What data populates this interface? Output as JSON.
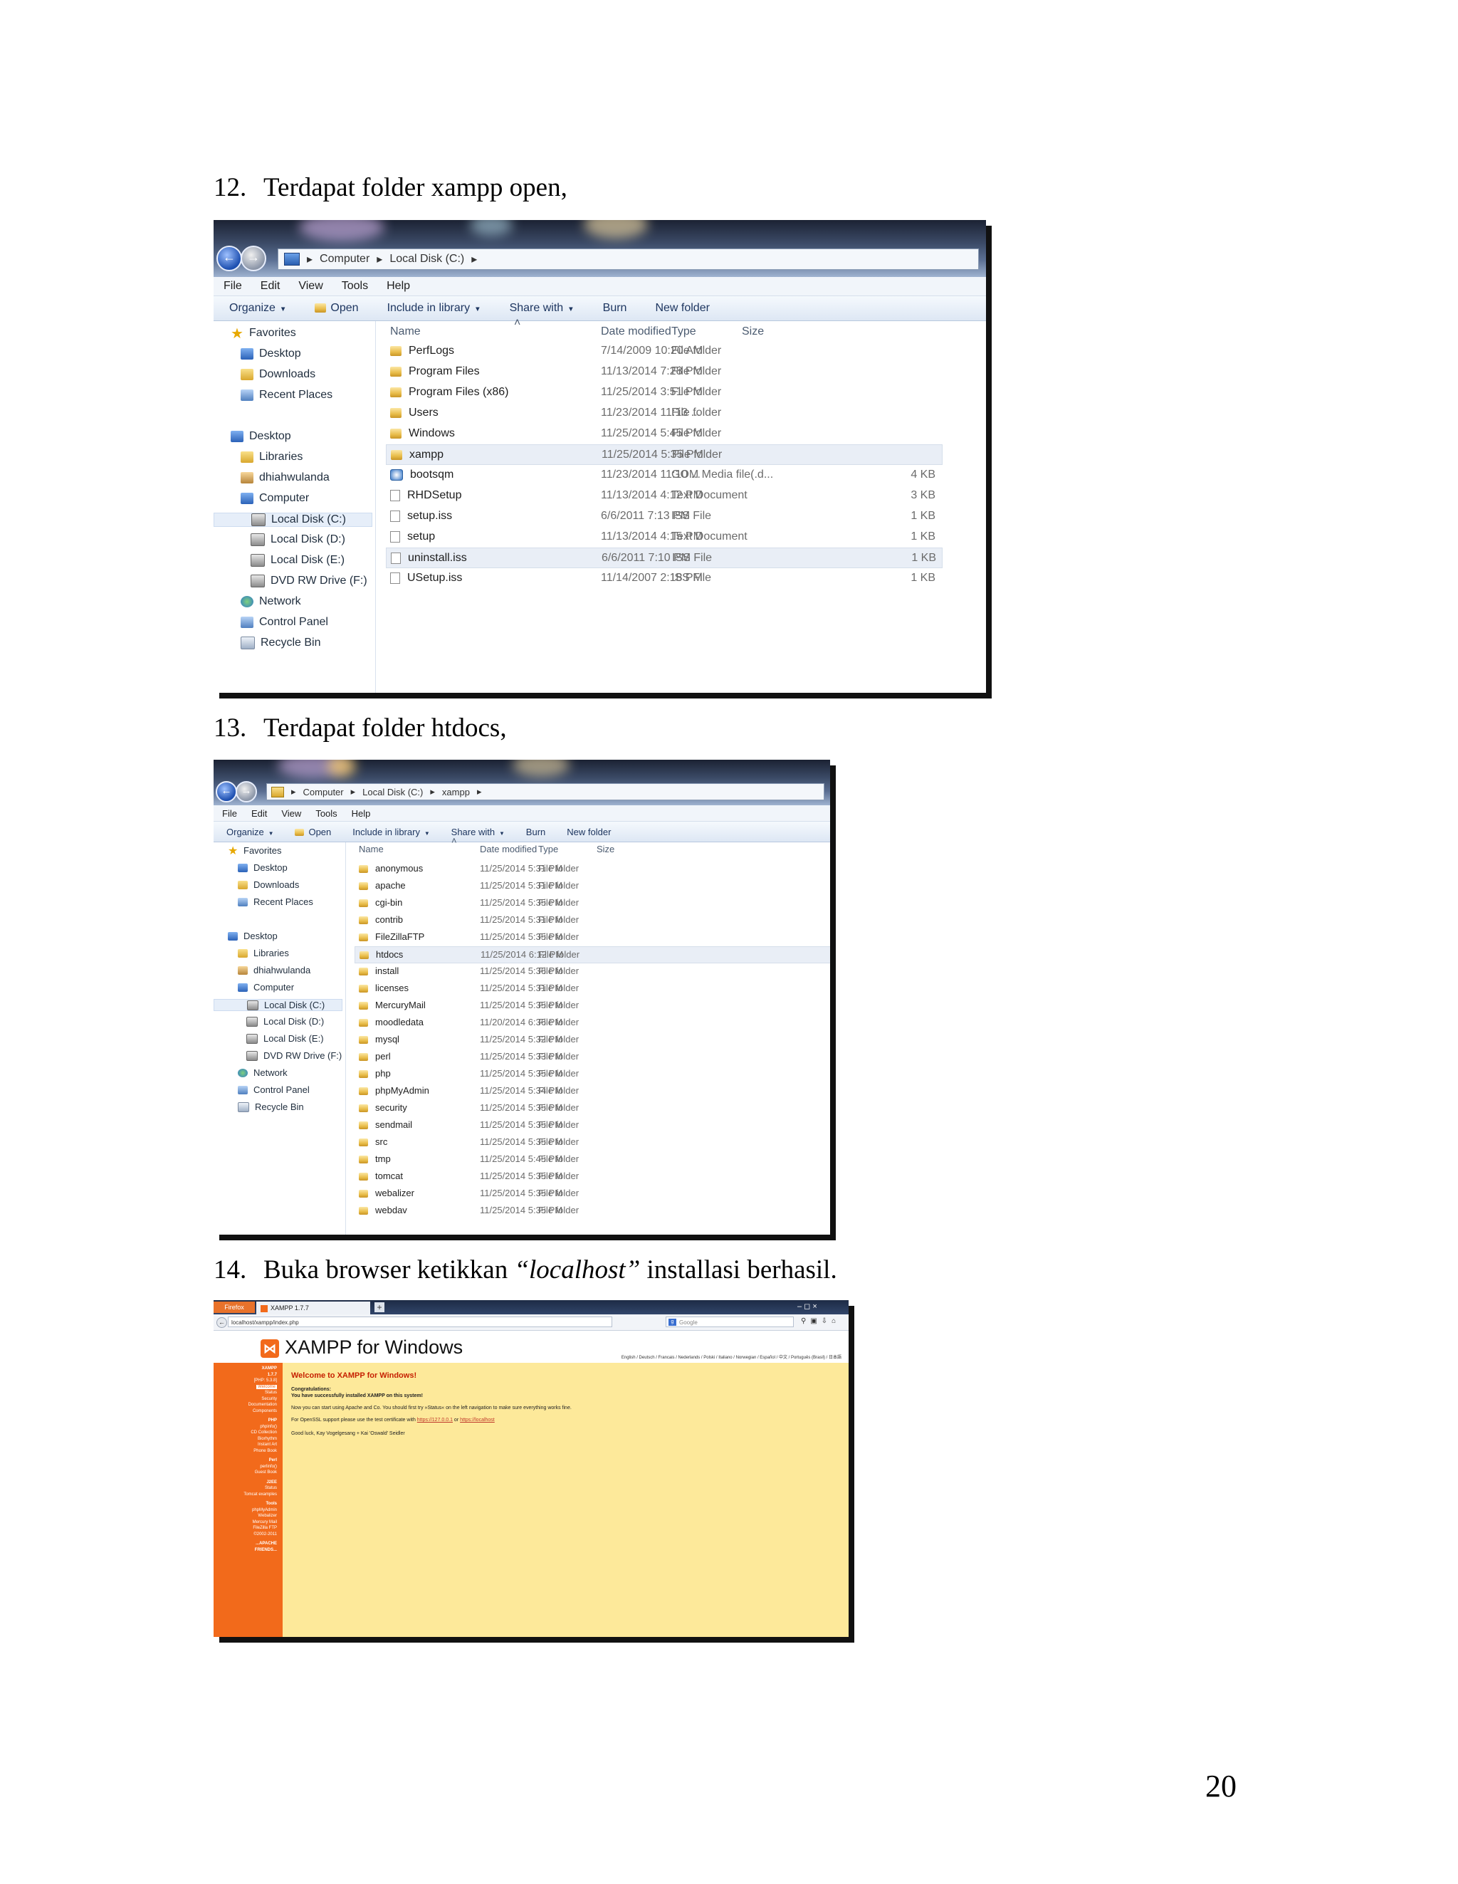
{
  "captions": [
    {
      "num": "12.",
      "text": "Terdapat folder xampp open,"
    },
    {
      "num": "13.",
      "text": "Terdapat folder htdocs,"
    },
    {
      "num": "14.",
      "pre": "Buka browser ketikkan ",
      "em": "“localhost”",
      "post": " installasi berhasil."
    }
  ],
  "page_number": "20",
  "explorer1": {
    "breadcrumb": [
      "Computer",
      "Local Disk (C:)"
    ],
    "menu": [
      "File",
      "Edit",
      "View",
      "Tools",
      "Help"
    ],
    "toolbar": [
      "Organize",
      "Open",
      "Include in library",
      "Share with",
      "Burn",
      "New folder"
    ],
    "columns": [
      "Name",
      "Date modified",
      "Type",
      "Size"
    ],
    "nav": [
      {
        "label": "Favorites",
        "icon": "star"
      },
      {
        "label": "Desktop",
        "icon": "blue"
      },
      {
        "label": "Downloads",
        "icon": "folder"
      },
      {
        "label": "Recent Places",
        "icon": "cp"
      },
      {
        "label": "Desktop",
        "icon": "blue"
      },
      {
        "label": "Libraries",
        "icon": "folder"
      },
      {
        "label": "dhiahwulanda",
        "icon": "user"
      },
      {
        "label": "Computer",
        "icon": "blue"
      },
      {
        "label": "Local Disk (C:)",
        "icon": "drive"
      },
      {
        "label": "Local Disk (D:)",
        "icon": "drive"
      },
      {
        "label": "Local Disk (E:)",
        "icon": "drive"
      },
      {
        "label": "DVD RW Drive (F:)",
        "icon": "drive"
      },
      {
        "label": "Network",
        "icon": "globe"
      },
      {
        "label": "Control Panel",
        "icon": "cp"
      },
      {
        "label": "Recycle Bin",
        "icon": "bin"
      }
    ],
    "files": [
      {
        "name": "PerfLogs",
        "date": "7/14/2009 10:20 AM",
        "type": "File folder",
        "size": "",
        "icon": "folder"
      },
      {
        "name": "Program Files",
        "date": "11/13/2014 7:28 PM",
        "type": "File folder",
        "size": "",
        "icon": "folder"
      },
      {
        "name": "Program Files (x86)",
        "date": "11/25/2014 3:51 PM",
        "type": "File folder",
        "size": "",
        "icon": "folder"
      },
      {
        "name": "Users",
        "date": "11/23/2014 11:13 ...",
        "type": "File folder",
        "size": "",
        "icon": "folder"
      },
      {
        "name": "Windows",
        "date": "11/25/2014 5:45 PM",
        "type": "File folder",
        "size": "",
        "icon": "folder"
      },
      {
        "name": "xampp",
        "date": "11/25/2014 5:35 PM",
        "type": "File folder",
        "size": "",
        "icon": "folder"
      },
      {
        "name": "bootsqm",
        "date": "11/23/2014 11:10 ...",
        "type": "GOM Media file(.d...",
        "size": "4 KB",
        "icon": "media"
      },
      {
        "name": "RHDSetup",
        "date": "11/13/2014 4:12 PM",
        "type": "Text Document",
        "size": "3 KB",
        "icon": "doc"
      },
      {
        "name": "setup.iss",
        "date": "6/6/2011 7:13 PM",
        "type": "ISS File",
        "size": "1 KB",
        "icon": "doc"
      },
      {
        "name": "setup",
        "date": "11/13/2014 4:15 PM",
        "type": "Text Document",
        "size": "1 KB",
        "icon": "doc"
      },
      {
        "name": "uninstall.iss",
        "date": "6/6/2011 7:10 PM",
        "type": "ISS File",
        "size": "1 KB",
        "icon": "doc"
      },
      {
        "name": "USetup.iss",
        "date": "11/14/2007 2:18 PM",
        "type": "ISS File",
        "size": "1 KB",
        "icon": "doc"
      }
    ]
  },
  "explorer2": {
    "breadcrumb": [
      "Computer",
      "Local Disk (C:)",
      "xampp"
    ],
    "menu": [
      "File",
      "Edit",
      "View",
      "Tools",
      "Help"
    ],
    "toolbar": [
      "Organize",
      "Open",
      "Include in library",
      "Share with",
      "Burn",
      "New folder"
    ],
    "columns": [
      "Name",
      "Date modified",
      "Type",
      "Size"
    ],
    "nav": [
      {
        "label": "Favorites",
        "icon": "star"
      },
      {
        "label": "Desktop",
        "icon": "blue"
      },
      {
        "label": "Downloads",
        "icon": "folder"
      },
      {
        "label": "Recent Places",
        "icon": "cp"
      },
      {
        "label": "Desktop",
        "icon": "blue"
      },
      {
        "label": "Libraries",
        "icon": "folder"
      },
      {
        "label": "dhiahwulanda",
        "icon": "user"
      },
      {
        "label": "Computer",
        "icon": "blue"
      },
      {
        "label": "Local Disk (C:)",
        "icon": "drive"
      },
      {
        "label": "Local Disk (D:)",
        "icon": "drive"
      },
      {
        "label": "Local Disk (E:)",
        "icon": "drive"
      },
      {
        "label": "DVD RW Drive (F:)",
        "icon": "drive"
      },
      {
        "label": "Network",
        "icon": "globe"
      },
      {
        "label": "Control Panel",
        "icon": "cp"
      },
      {
        "label": "Recycle Bin",
        "icon": "bin"
      }
    ],
    "files": [
      {
        "name": "anonymous",
        "date": "11/25/2014 5:31 PM",
        "type": "File folder"
      },
      {
        "name": "apache",
        "date": "11/25/2014 5:31 PM",
        "type": "File folder"
      },
      {
        "name": "cgi-bin",
        "date": "11/25/2014 5:35 PM",
        "type": "File folder"
      },
      {
        "name": "contrib",
        "date": "11/25/2014 5:31 PM",
        "type": "File folder"
      },
      {
        "name": "FileZillaFTP",
        "date": "11/25/2014 5:35 PM",
        "type": "File folder"
      },
      {
        "name": "htdocs",
        "date": "11/25/2014 6:12 PM",
        "type": "File folder"
      },
      {
        "name": "install",
        "date": "11/25/2014 5:36 PM",
        "type": "File folder"
      },
      {
        "name": "licenses",
        "date": "11/25/2014 5:31 PM",
        "type": "File folder"
      },
      {
        "name": "MercuryMail",
        "date": "11/25/2014 5:35 PM",
        "type": "File folder"
      },
      {
        "name": "moodledata",
        "date": "11/20/2014 6:36 PM",
        "type": "File folder"
      },
      {
        "name": "mysql",
        "date": "11/25/2014 5:32 PM",
        "type": "File folder"
      },
      {
        "name": "perl",
        "date": "11/25/2014 5:33 PM",
        "type": "File folder"
      },
      {
        "name": "php",
        "date": "11/25/2014 5:35 PM",
        "type": "File folder"
      },
      {
        "name": "phpMyAdmin",
        "date": "11/25/2014 5:34 PM",
        "type": "File folder"
      },
      {
        "name": "security",
        "date": "11/25/2014 5:35 PM",
        "type": "File folder"
      },
      {
        "name": "sendmail",
        "date": "11/25/2014 5:35 PM",
        "type": "File folder"
      },
      {
        "name": "src",
        "date": "11/25/2014 5:35 PM",
        "type": "File folder"
      },
      {
        "name": "tmp",
        "date": "11/25/2014 5:45 PM",
        "type": "File folder"
      },
      {
        "name": "tomcat",
        "date": "11/25/2014 5:35 PM",
        "type": "File folder"
      },
      {
        "name": "webalizer",
        "date": "11/25/2014 5:35 PM",
        "type": "File folder"
      },
      {
        "name": "webdav",
        "date": "11/25/2014 5:35 PM",
        "type": "File folder"
      }
    ]
  },
  "browser": {
    "ff_button": "Firefox",
    "tab_title": "XAMPP 1.7.7",
    "url": "localhost/xampp/index.php",
    "search_placeholder": "Google",
    "win_controls": "–  ◻  ×",
    "app_title": "XAMPP for Windows",
    "languages": "English / Deutsch / Francais / Nederlands / Polski / Italiano / Norwegian / Español / 中文 / Português (Brasil) / 日本語",
    "sidebar": [
      {
        "text": "XAMPP",
        "kind": "h"
      },
      {
        "text": "1.7.7",
        "kind": "h"
      },
      {
        "text": "[PHP: 5.3.8]",
        "kind": "n"
      },
      {
        "text": "Welcome",
        "kind": "active"
      },
      {
        "text": "Status",
        "kind": "n"
      },
      {
        "text": "Security",
        "kind": "n"
      },
      {
        "text": "Documentation",
        "kind": "n"
      },
      {
        "text": "Components",
        "kind": "n"
      },
      {
        "text": "PHP",
        "kind": "h"
      },
      {
        "text": "phpinfo()",
        "kind": "n"
      },
      {
        "text": "CD Collection",
        "kind": "n"
      },
      {
        "text": "Biorhythm",
        "kind": "n"
      },
      {
        "text": "Instant Art",
        "kind": "n"
      },
      {
        "text": "Phone Book",
        "kind": "n"
      },
      {
        "text": "Perl",
        "kind": "h"
      },
      {
        "text": "perlinfo()",
        "kind": "n"
      },
      {
        "text": "Guest Book",
        "kind": "n"
      },
      {
        "text": "J2EE",
        "kind": "h"
      },
      {
        "text": "Status",
        "kind": "n"
      },
      {
        "text": "Tomcat examples",
        "kind": "n"
      },
      {
        "text": "Tools",
        "kind": "h"
      },
      {
        "text": "phpMyAdmin",
        "kind": "n"
      },
      {
        "text": "Webalizer",
        "kind": "n"
      },
      {
        "text": "Mercury Mail",
        "kind": "n"
      },
      {
        "text": "FileZilla FTP",
        "kind": "n"
      },
      {
        "text": "©2002-2011",
        "kind": "n"
      },
      {
        "text": "...APACHE",
        "kind": "h"
      },
      {
        "text": "FRIENDS...",
        "kind": "h"
      }
    ],
    "welcome_heading": "Welcome to XAMPP for Windows!",
    "congrats": "Congratulations:",
    "success": "You have successfully installed XAMPP on this system!",
    "para1": "Now you can start using Apache and Co. You should first try »Status« on the left navigation to make sure everything works fine.",
    "para2_pre": "For OpenSSL support please use the test certificate with ",
    "link1": "https://127.0.0.1",
    "para2_mid": " or ",
    "link2": "https://localhost",
    "signoff": "Good luck, Kay Vogelgesang + Kai 'Oswald' Seidler"
  }
}
